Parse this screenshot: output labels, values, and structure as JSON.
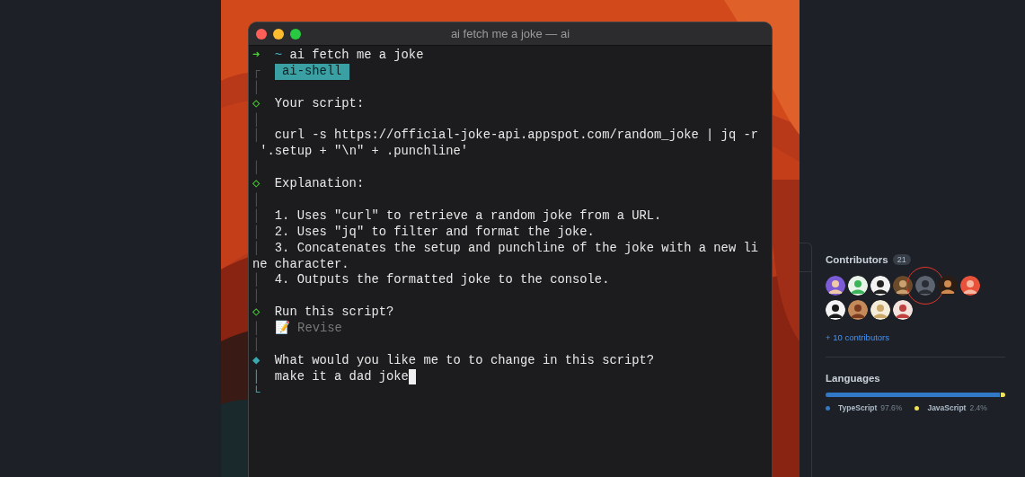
{
  "terminal": {
    "title": "ai fetch me a joke — ai",
    "rows": [
      {
        "kind": "prompt",
        "gutter": "➜",
        "dir": "~",
        "text": "ai fetch me a joke"
      },
      {
        "kind": "badge",
        "gutter": "┌",
        "text": "ai-shell"
      },
      {
        "kind": "plain",
        "gutter": "│",
        "text": ""
      },
      {
        "kind": "step",
        "gutter": "◇",
        "text": "Your script:"
      },
      {
        "kind": "plain",
        "gutter": "│",
        "text": ""
      },
      {
        "kind": "plain",
        "gutter": "│",
        "text": "curl -s https://official-joke-api.appspot.com/random_joke | jq -r"
      },
      {
        "kind": "wrap",
        "text": " '.setup + \"\\n\" + .punchline'"
      },
      {
        "kind": "plain",
        "gutter": "│",
        "text": ""
      },
      {
        "kind": "step",
        "gutter": "◇",
        "text": "Explanation:"
      },
      {
        "kind": "plain",
        "gutter": "│",
        "text": ""
      },
      {
        "kind": "plain",
        "gutter": "│",
        "text": "1. Uses \"curl\" to retrieve a random joke from a URL."
      },
      {
        "kind": "plain",
        "gutter": "│",
        "text": "2. Uses \"jq\" to filter and format the joke."
      },
      {
        "kind": "plain",
        "gutter": "│",
        "text": "3. Concatenates the setup and punchline of the joke with a new li"
      },
      {
        "kind": "wrap",
        "text": "ne character."
      },
      {
        "kind": "plain",
        "gutter": "│",
        "text": "4. Outputs the formatted joke to the console."
      },
      {
        "kind": "plain",
        "gutter": "│",
        "text": ""
      },
      {
        "kind": "step",
        "gutter": "◇",
        "text": "Run this script?"
      },
      {
        "kind": "option",
        "gutter": "│",
        "icon": "📝",
        "text": "Revise"
      },
      {
        "kind": "plain",
        "gutter": "│",
        "text": ""
      },
      {
        "kind": "active",
        "gutter": "◆",
        "text": "What would you like me to to change in this script?"
      },
      {
        "kind": "input",
        "gutter": "│",
        "text": "make it a dad joke"
      },
      {
        "kind": "end",
        "gutter": "└",
        "text": ""
      }
    ]
  },
  "sidebar": {
    "contributors": {
      "title": "Contributors",
      "count": "21",
      "avatars": [
        {
          "kind": "picture",
          "highlighted": false
        },
        {
          "kind": "picture",
          "highlighted": false
        },
        {
          "kind": "picture",
          "highlighted": false
        },
        {
          "kind": "picture",
          "highlighted": false
        },
        {
          "kind": "picture",
          "highlighted": true
        },
        {
          "kind": "picture",
          "highlighted": false
        },
        {
          "kind": "picture",
          "highlighted": false
        },
        {
          "kind": "picture",
          "highlighted": false
        },
        {
          "kind": "picture",
          "highlighted": false
        },
        {
          "kind": "picture",
          "highlighted": false
        },
        {
          "kind": "picture",
          "highlighted": false
        }
      ],
      "more_link": "+ 10 contributors"
    },
    "languages": {
      "title": "Languages",
      "items": [
        {
          "name": "TypeScript",
          "percent": "97.6%",
          "color": "#3178c6"
        },
        {
          "name": "JavaScript",
          "percent": "2.4%",
          "color": "#f1e05a"
        }
      ]
    }
  }
}
